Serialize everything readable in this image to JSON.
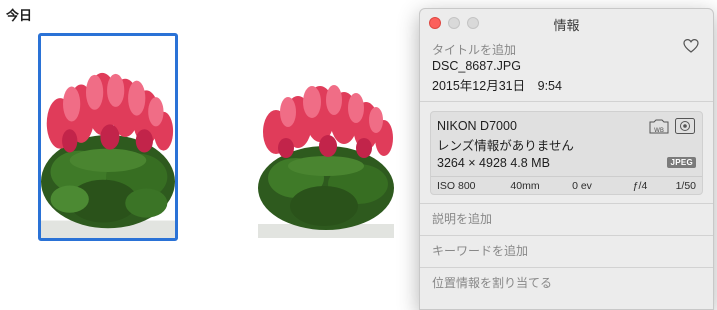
{
  "day_label": "今日",
  "photos": [
    {
      "name": "DSC_8687.JPG",
      "selected": true
    },
    {
      "name": "",
      "selected": false
    }
  ],
  "info_window": {
    "title": "情報",
    "title_placeholder": "タイトルを追加",
    "filename": "DSC_8687.JPG",
    "datetime": "2015年12月31日　9:54",
    "camera": {
      "model": "NIKON D7000",
      "lens": "レンズ情報がありません",
      "size_line": "3264 × 4928 4.8 MB",
      "format_badge": "JPEG",
      "iso": "ISO 800",
      "focal_length": "40mm",
      "exposure_bias": "0 ev",
      "aperture": "ƒ/4",
      "shutter": "1/50"
    },
    "description_placeholder": "説明を追加",
    "keyword_placeholder": "キーワードを追加",
    "location_placeholder": "位置情報を割り当てる"
  },
  "colors": {
    "selection_border": "#2a72d6",
    "close_button": "#fc605c",
    "panel_bg": "#ececec"
  },
  "icons": [
    "close-icon",
    "minimize-icon",
    "zoom-icon",
    "heart-icon",
    "white-balance-icon",
    "metering-icon"
  ]
}
